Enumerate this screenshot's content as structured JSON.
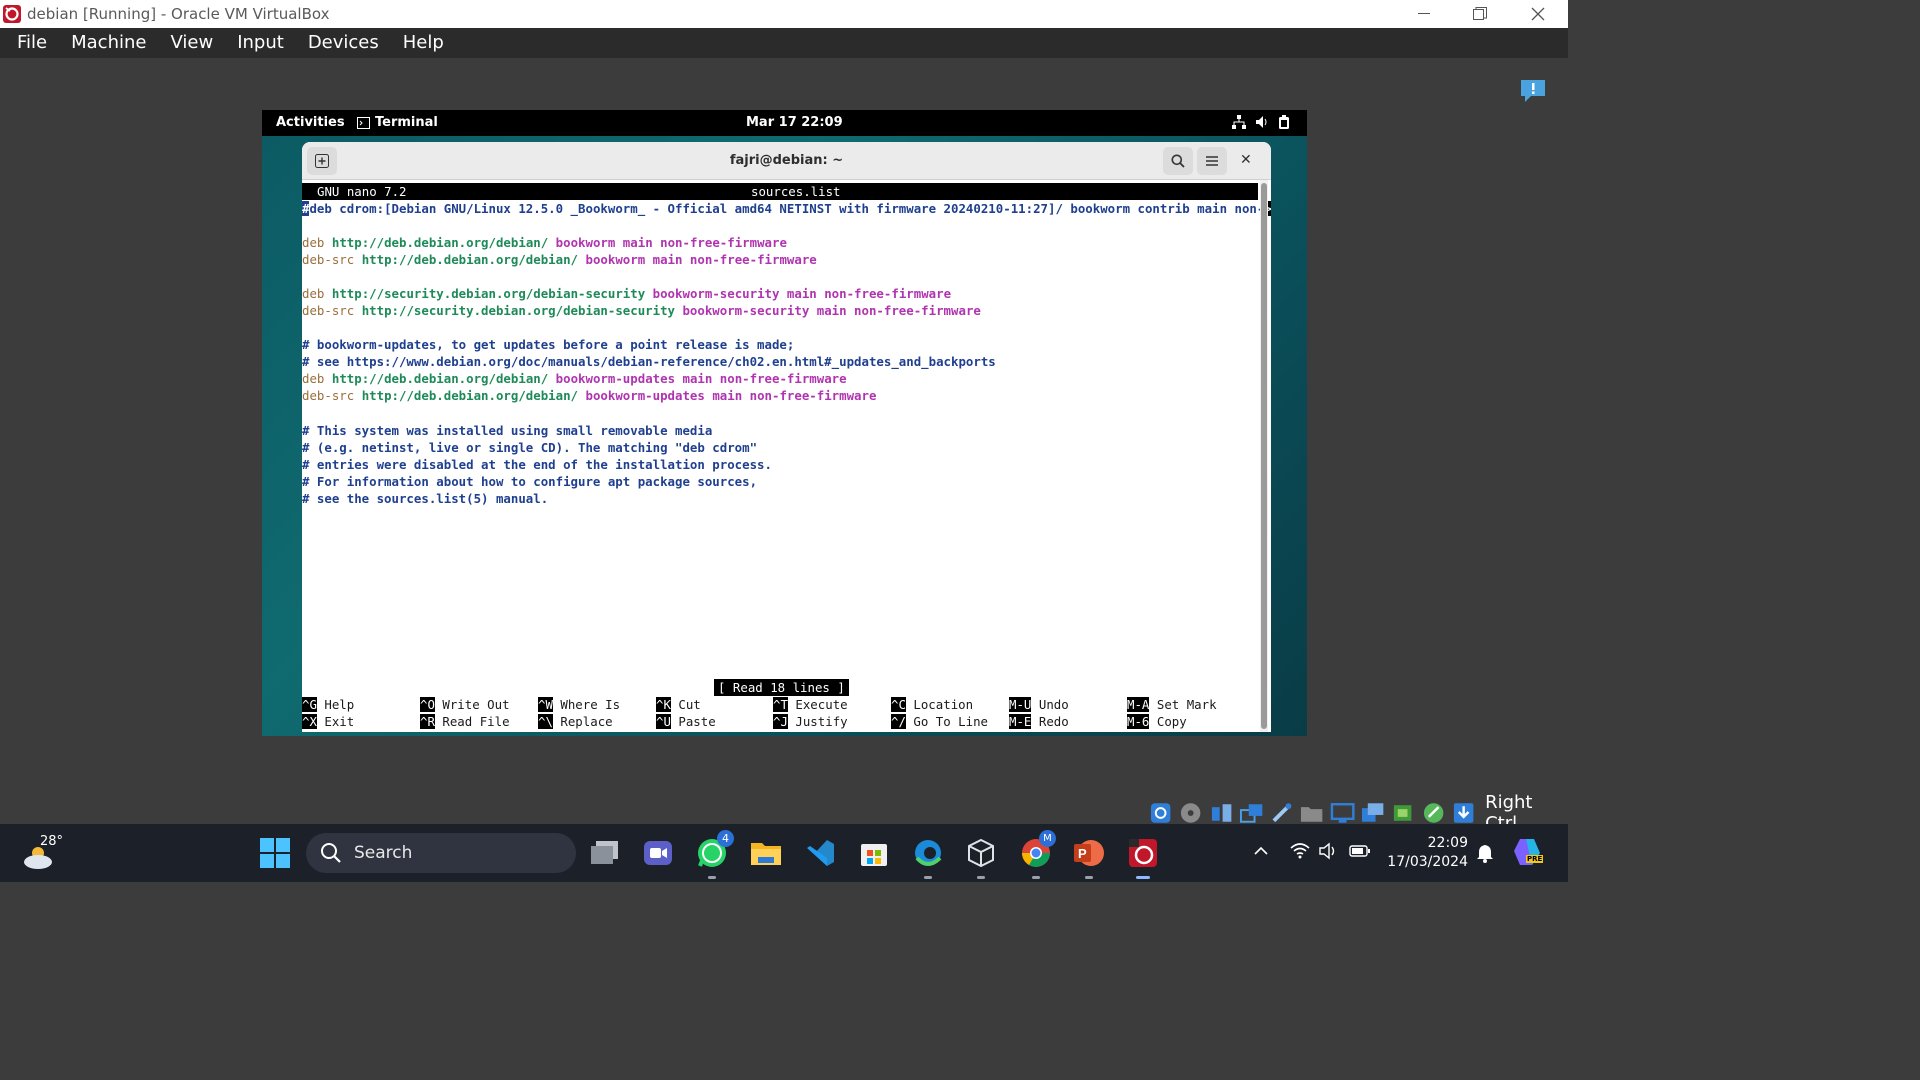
{
  "host_window": {
    "title": "debian [Running] - Oracle VM VirtualBox",
    "menu": [
      "File",
      "Machine",
      "View",
      "Input",
      "Devices",
      "Help"
    ]
  },
  "guest": {
    "top_bar": {
      "activities": "Activities",
      "app_name": "Terminal",
      "datetime": "Mar 17  22:09"
    },
    "terminal": {
      "title": "fajri@debian: ~",
      "nano_version": "GNU nano 7.2",
      "filename": "sources.list",
      "first_line_cursor": "#",
      "first_line_rest": "deb cdrom:[Debian GNU/Linux 12.5.0 _Bookworm_ - Official amd64 NETINST with firmware 20240210-11:27]/ bookworm contrib main non-",
      "truncation_marker": ">",
      "lines": {
        "l3": {
          "type": "deb",
          "url": "http://deb.debian.org/debian/",
          "suite": "bookworm main non-free-firmware"
        },
        "l4": {
          "type": "deb-src",
          "url": "http://deb.debian.org/debian/",
          "suite": "bookworm main non-free-firmware"
        },
        "l6": {
          "type": "deb",
          "url": "http://security.debian.org/debian-security",
          "suite": "bookworm-security main non-free-firmware"
        },
        "l7": {
          "type": "deb-src",
          "url": "http://security.debian.org/debian-security",
          "suite": "bookworm-security main non-free-firmware"
        },
        "l9": "# bookworm-updates, to get updates before a point release is made;",
        "l10": "# see https://www.debian.org/doc/manuals/debian-reference/ch02.en.html#_updates_and_backports",
        "l11": {
          "type": "deb",
          "url": "http://deb.debian.org/debian/",
          "suite": "bookworm-updates main non-free-firmware"
        },
        "l12": {
          "type": "deb-src",
          "url": "http://deb.debian.org/debian/",
          "suite": "bookworm-updates main non-free-firmware"
        },
        "l14": "# This system was installed using small removable media",
        "l15": "# (e.g. netinst, live or single CD). The matching \"deb cdrom\"",
        "l16": "# entries were disabled at the end of the installation process.",
        "l17": "# For information about how to configure apt package sources,",
        "l18": "# see the sources.list(5) manual."
      },
      "status": "[ Read 18 lines ]",
      "shortcuts": {
        "help": {
          "key": "^G",
          "label": "Help"
        },
        "exit": {
          "key": "^X",
          "label": "Exit"
        },
        "write_out": {
          "key": "^O",
          "label": "Write Out"
        },
        "read_file": {
          "key": "^R",
          "label": "Read File"
        },
        "where_is": {
          "key": "^W",
          "label": "Where Is"
        },
        "replace": {
          "key": "^\\",
          "label": "Replace"
        },
        "cut": {
          "key": "^K",
          "label": "Cut"
        },
        "paste": {
          "key": "^U",
          "label": "Paste"
        },
        "execute": {
          "key": "^T",
          "label": "Execute"
        },
        "justify": {
          "key": "^J",
          "label": "Justify"
        },
        "location": {
          "key": "^C",
          "label": "Location"
        },
        "go_to_line": {
          "key": "^/",
          "label": "Go To Line"
        },
        "undo": {
          "key": "M-U",
          "label": "Undo"
        },
        "redo": {
          "key": "M-E",
          "label": "Redo"
        },
        "set_mark": {
          "key": "M-A",
          "label": "Set Mark"
        },
        "copy": {
          "key": "M-6",
          "label": "Copy"
        }
      }
    }
  },
  "vbox_status": {
    "host_key": "Right Ctrl"
  },
  "taskbar": {
    "weather_temp": "28°",
    "search_placeholder": "Search",
    "whatsapp_badge": "4",
    "chrome_profile": "M",
    "time": "22:09",
    "date": "17/03/2024",
    "copilot_badge": "PRE"
  },
  "colors": {
    "comment": "#1f3f8f",
    "url": "#1e8a58",
    "suite": "#b034b0",
    "type": "#9b6f3a",
    "taskbar": "#1c2029"
  }
}
